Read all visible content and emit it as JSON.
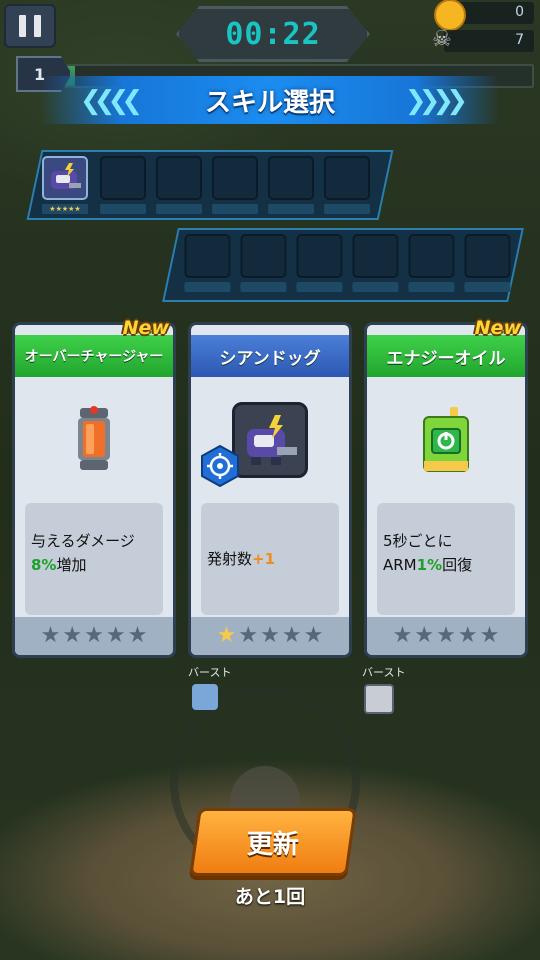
{
  "hud": {
    "timer": "00:22",
    "coins": "0",
    "kills": "7",
    "level": "1",
    "xp_fraction": 0.02
  },
  "title": "スキル選択",
  "cards": [
    {
      "name": "オーバーチャージャー",
      "new_badge": "New",
      "desc_line1": "与えるダメージ",
      "desc_hl": "8%",
      "desc_line2_rest": "増加",
      "stars_filled": 0,
      "stars_total": 5,
      "header_color": "green",
      "icon": "capsule-icon"
    },
    {
      "name": "シアンドッグ",
      "new_badge": "",
      "desc_line1": "発射数",
      "desc_hl": "+1",
      "stars_filled": 1,
      "stars_total": 5,
      "header_color": "blue",
      "icon": "robot-dog-icon"
    },
    {
      "name": "エナジーオイル",
      "new_badge": "New",
      "desc_line1": "5秒ごとに",
      "desc_line2_pre": "ARM",
      "desc_hl": "1%",
      "desc_line2_rest": "回復",
      "stars_filled": 0,
      "stars_total": 5,
      "header_color": "green",
      "icon": "oil-can-icon"
    }
  ],
  "burst_labels": [
    "バースト",
    "バースト"
  ],
  "refresh_label": "更新",
  "remaining_text": "あと1回",
  "colors": {
    "accent_cyan": "#18c4c4",
    "header_green": "#21a62d",
    "header_blue": "#2c58b3",
    "star_on": "#f6c94c",
    "button_orange": "#f07d12"
  }
}
